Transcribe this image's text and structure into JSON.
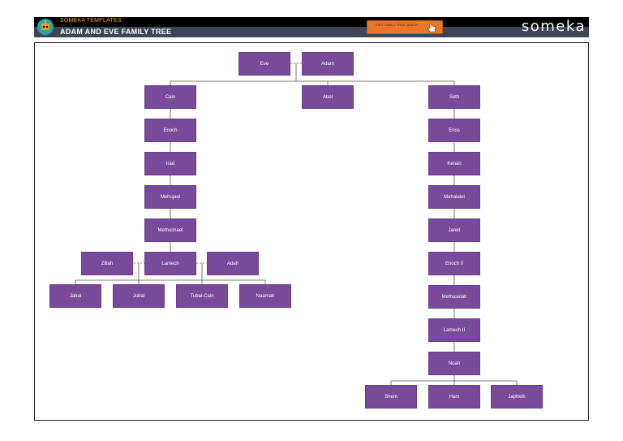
{
  "header": {
    "brand_small": "SOMEKA TEMPLATES",
    "title": "ADAM AND EVE FAMILY TREE",
    "visit_button_label": "VISIT FAMILY TREE MAKER",
    "logo_text": "someka",
    "icons": {
      "logo": "robot-logo-icon",
      "button": "hand-pointer-icon"
    }
  },
  "colors": {
    "node": "#7a4a9a",
    "header": "#000000",
    "subbar": "#3e4656",
    "button": "#e8762b",
    "accent": "#f2a21b"
  },
  "tree": {
    "eve": "Eve",
    "adam": "Adam",
    "cain": "Cain",
    "abel": "Abel",
    "seth": "Seth",
    "enoch": "Enoch",
    "irad": "Irad",
    "mehujael": "Mehujael",
    "methushael": "Methushael",
    "zillah": "Zillah",
    "lamech": "Lamech",
    "adah": "Adah",
    "jabal": "Jabal",
    "jubal": "Jubal",
    "tubal_cain": "Tubal-Cain",
    "naamah": "Naamah",
    "enos": "Enos",
    "kenan": "Kenan",
    "mahalalel": "Mahalalel",
    "jared": "Jared",
    "enoch_ii": "Enoch II",
    "methuselah": "Methuselah",
    "lamech_ii": "Lamech II",
    "noah": "Noah",
    "shem": "Shem",
    "ham": "Ham",
    "japheth": "Japheth"
  }
}
